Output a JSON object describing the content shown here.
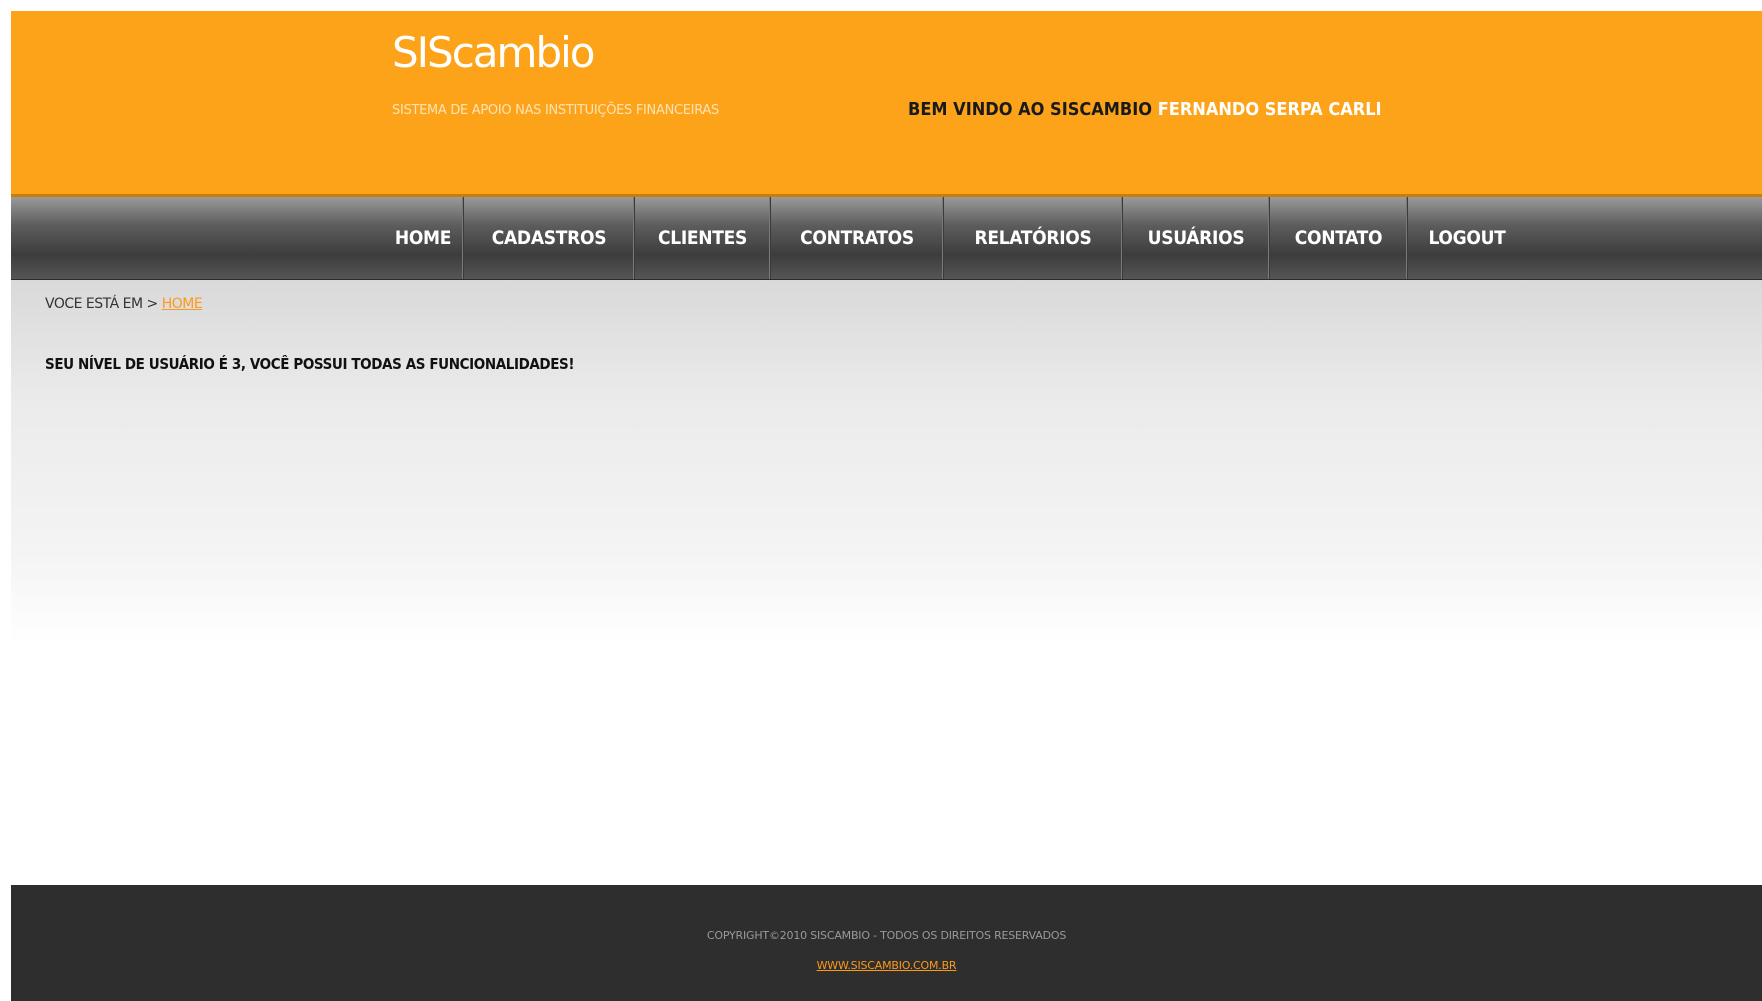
{
  "header": {
    "logo": "SIScambio",
    "tagline": "SISTEMA DE APOIO NAS INSTITUIÇÕES FINANCEIRAS",
    "welcome_prefix": "BEM VINDO AO SISCAMBIO",
    "welcome_user": "FERNANDO SERPA CARLI"
  },
  "nav": {
    "items": [
      {
        "label": "HOME"
      },
      {
        "label": "CADASTROS"
      },
      {
        "label": "CLIENTES"
      },
      {
        "label": "CONTRATOS"
      },
      {
        "label": "RELATÓRIOS"
      },
      {
        "label": "USUÁRIOS"
      },
      {
        "label": "CONTATO"
      },
      {
        "label": "LOGOUT"
      }
    ]
  },
  "content": {
    "breadcrumb_prefix": "VOCE ESTÁ EM >",
    "breadcrumb_link": "HOME",
    "notice": "SEU NÍVEL DE USUÁRIO É 3, VOCÊ POSSUI TODAS AS FUNCIONALIDADES!"
  },
  "footer": {
    "copyright": "COPYRIGHT©2010 SISCAMBIO - TODOS OS DIREITOS RESERVADOS",
    "site_link": "WWW.SISCAMBIO.COM.BR"
  },
  "colors": {
    "header_bg": "#fda31a",
    "nav_bg": "#4a4a4a",
    "accent": "#fd9a1a",
    "footer_bg": "#2e2e2e"
  }
}
